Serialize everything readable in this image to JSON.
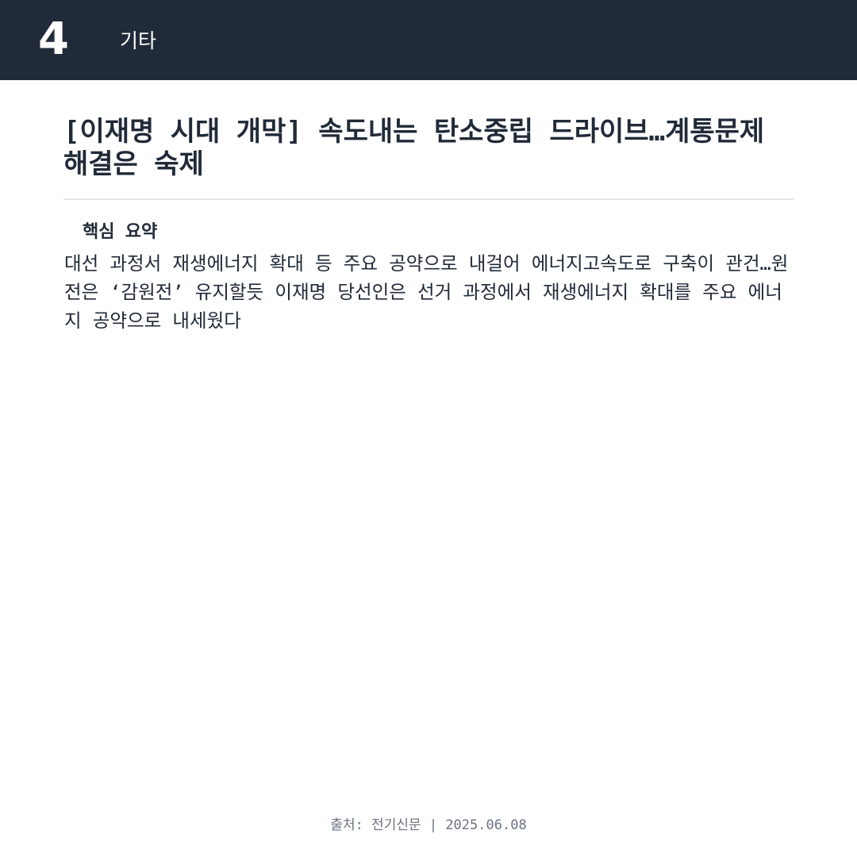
{
  "header": {
    "number": "4",
    "category": "기타"
  },
  "article": {
    "title": "[이재명 시대 개막] 속도내는 탄소중립 드라이브…계통문제 해결은 숙제",
    "summary_label": "핵심 요약",
    "summary_text": "대선 과정서 재생에너지 확대 등 주요 공약으로 내걸어 에너지고속도로 구축이 관건…원전은 ‘감원전’ 유지할듯 이재명 당선인은 선거 과정에서 재생에너지 확대를 주요 에너지 공약으로 내세웠다"
  },
  "footer": {
    "source": "출처: 전기신문 | 2025.06.08"
  },
  "colors": {
    "header_background": "#212a38",
    "text": "#212a38",
    "footer_text": "#6b7280",
    "divider": "#e5e7eb"
  }
}
